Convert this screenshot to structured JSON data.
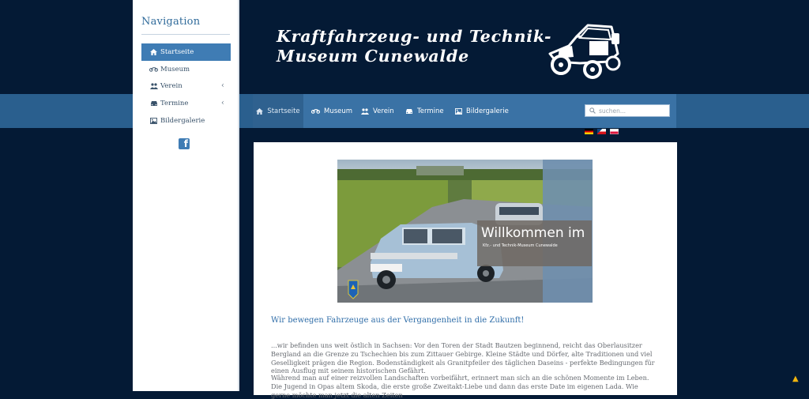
{
  "sidebar": {
    "title": "Navigation",
    "items": [
      {
        "label": "Startseite",
        "icon": "home-icon",
        "active": true
      },
      {
        "label": "Museum",
        "icon": "motorcycle-icon"
      },
      {
        "label": "Verein",
        "icon": "users-icon",
        "submenu": "‹"
      },
      {
        "label": "Termine",
        "icon": "car-icon",
        "submenu": "‹"
      },
      {
        "label": "Bildergalerie",
        "icon": "image-icon"
      }
    ],
    "social_icon": "facebook-icon",
    "social_glyph": "f"
  },
  "header": {
    "title_line1": "Kraftfahrzeug- und Technik-",
    "title_line2": "Museum Cunewalde",
    "logo_icon": "vintage-car-icon"
  },
  "topnav": {
    "items": [
      {
        "label": "Startseite",
        "icon": "home-icon",
        "active": true
      },
      {
        "label": "Museum",
        "icon": "motorcycle-icon"
      },
      {
        "label": "Verein",
        "icon": "users-icon"
      },
      {
        "label": "Termine",
        "icon": "car-icon"
      },
      {
        "label": "Bildergalerie",
        "icon": "image-icon"
      }
    ],
    "search_placeholder": "suchen..."
  },
  "languages": [
    "de",
    "cz",
    "pl"
  ],
  "content": {
    "hero_title": "Willkommen im",
    "hero_subtitle": "Kfz.- und Technik-Museum Cunewalde",
    "welcome": "Wir bewegen Fahrzeuge aus der Vergangenheit in die Zukunft!",
    "paragraph1": "...wir befinden uns weit östlich in Sachsen: Vor den Toren der Stadt Bautzen beginnend, reicht das Oberlausitzer Bergland an die Grenze zu Tschechien bis zum Zittauer Gebirge. Kleine Städte und Dörfer, alte Traditionen und viel Geselligkeit prägen die Region. Bodenständigkeit als Granitpfeiler des täglichen Daseins - perfekte Bedingungen für einen Ausflug mit seinem historischen Gefährt.",
    "paragraph2": "Während man auf einer reizvollen Landschaften vorbeifährt, erinnert man sich an die schönen Momente im Leben. Die Jugend in Opas altem Skoda, die erste große Zweitakt-Liebe und dann das erste Date im eigenen Lada. Wie gerne möchte man jetzt die alten Zeiten"
  },
  "colors": {
    "background": "#041a35",
    "nav_blue": "#3a72a5",
    "accent": "#2f6da8",
    "to_top": "#f0b40f"
  },
  "back_to_top": "▲"
}
